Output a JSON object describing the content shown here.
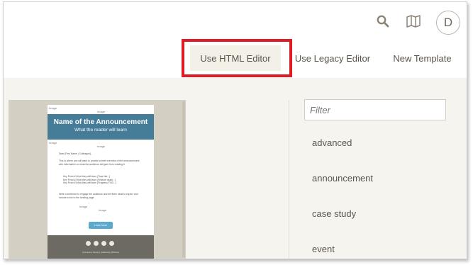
{
  "header": {
    "search_icon": "search-icon",
    "map_icon": "map-icon",
    "avatar_initial": "D",
    "tabs": [
      {
        "label": "Use HTML Editor",
        "highlighted": true
      },
      {
        "label": "Use Legacy Editor"
      },
      {
        "label": "New Template"
      }
    ],
    "highlight_color": "#e01b24"
  },
  "preview": {
    "image_placeholder": "Image",
    "banner_title": "Name of the Announcement",
    "banner_subtitle": "What the reader will learn",
    "banner_color": "#457c98",
    "greeting": "Dear [First Name | Colleague],",
    "intro": "This is where you will want to provide a brief overview of the announcement with information on what the audience will gain from reading it.",
    "bullets": [
      "Key Point #1 that they will learn [Topic list...]",
      "Key Point #2 that they will learn [Feature deals...]",
      "Key Point #3 that they will learn [Progress POD...]"
    ],
    "closing": "Write a sentence to engage the audience and tell them what to expect and include a link to the landing page.",
    "cta_label": "Learn More",
    "footer_text": "[Company Name] | [Address] | [Phone]"
  },
  "sidebar": {
    "filter_placeholder": "Filter",
    "categories": [
      "advanced",
      "announcement",
      "case study",
      "event"
    ]
  }
}
